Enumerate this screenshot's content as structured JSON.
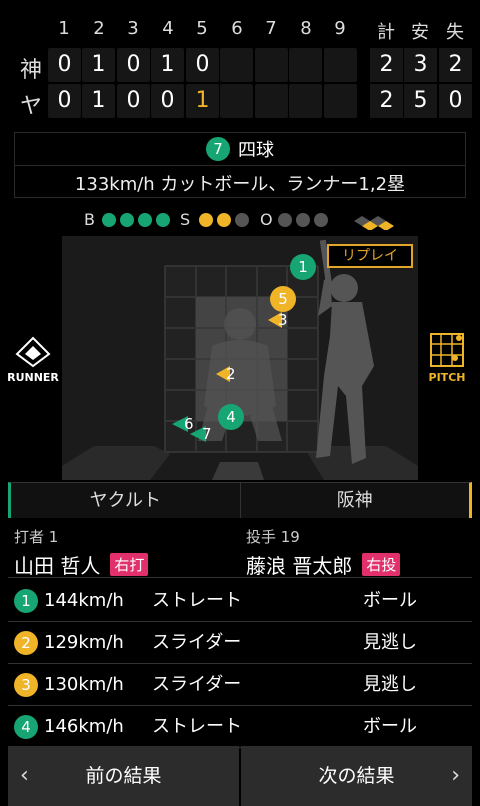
{
  "scoreboard": {
    "innings": [
      "1",
      "2",
      "3",
      "4",
      "5",
      "6",
      "7",
      "8",
      "9"
    ],
    "totals_headers": [
      "計",
      "安",
      "失"
    ],
    "teams": [
      {
        "label": "神",
        "scores": [
          "0",
          "1",
          "0",
          "1",
          "0",
          "",
          "",
          "",
          ""
        ],
        "totals": [
          "2",
          "3",
          "2"
        ]
      },
      {
        "label": "ヤ",
        "scores": [
          "0",
          "1",
          "0",
          "0",
          "1",
          "",
          "",
          "",
          ""
        ],
        "totals": [
          "2",
          "5",
          "0"
        ]
      }
    ]
  },
  "result": {
    "number": "7",
    "outcome": "四球",
    "detail": "133km/h カットボール、ランナー1,2塁"
  },
  "count": {
    "b": "B",
    "s": "S",
    "o": "O"
  },
  "replay_label": "リプレイ",
  "side": {
    "runner": "RUNNER",
    "pitch": "PITCH"
  },
  "pitch_marks": [
    {
      "n": "1",
      "color": "#17a673",
      "shape": "circle"
    },
    {
      "n": "5",
      "color": "#f0b429",
      "shape": "circle"
    },
    {
      "n": "3",
      "color": "#f0b429",
      "shape": "triangle"
    },
    {
      "n": "2",
      "color": "#f0b429",
      "shape": "triangle"
    },
    {
      "n": "4",
      "color": "#17a673",
      "shape": "circle"
    },
    {
      "n": "6",
      "color": "#17a673",
      "shape": "triangle"
    },
    {
      "n": "7",
      "color": "#17a673",
      "shape": "triangle"
    }
  ],
  "tabs": {
    "left": "ヤクルト",
    "right": "阪神"
  },
  "batter": {
    "role": "打者 1",
    "name": "山田 哲人",
    "hand": "右打"
  },
  "pitcher": {
    "role": "投手 19",
    "name": "藤浪 晋太郎",
    "hand": "右投"
  },
  "pitches": [
    {
      "n": "1",
      "color": "#17a673",
      "speed": "144km/h",
      "type": "ストレート",
      "result": "ボール"
    },
    {
      "n": "2",
      "color": "#f0b429",
      "speed": "129km/h",
      "type": "スライダー",
      "result": "見逃し"
    },
    {
      "n": "3",
      "color": "#f0b429",
      "speed": "130km/h",
      "type": "スライダー",
      "result": "見逃し"
    },
    {
      "n": "4",
      "color": "#17a673",
      "speed": "146km/h",
      "type": "ストレート",
      "result": "ボール"
    }
  ],
  "nav": {
    "prev": "前の結果",
    "next": "次の結果"
  }
}
